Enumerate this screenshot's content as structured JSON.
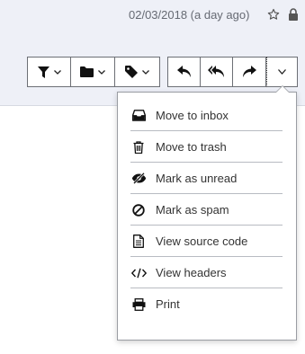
{
  "header": {
    "date": "02/03/2018 (a day ago)",
    "icons": [
      "star-icon",
      "lock-icon"
    ]
  },
  "toolbar": {
    "groups": [
      [
        "filter-icon",
        "folder-icon",
        "tag-icon"
      ],
      [
        "reply-icon",
        "reply-all-icon",
        "forward-icon"
      ],
      [
        "chevron-down-icon"
      ]
    ]
  },
  "menu": {
    "items": [
      {
        "label": "Move to inbox",
        "icon": "inbox-icon"
      },
      {
        "label": "Move to trash",
        "icon": "trash-icon"
      },
      {
        "label": "Mark as unread",
        "icon": "eye-slash-icon"
      },
      {
        "label": "Mark as spam",
        "icon": "ban-icon"
      },
      {
        "label": "View source code",
        "icon": "file-text-icon"
      },
      {
        "label": "View headers",
        "icon": "code-icon"
      },
      {
        "label": "Print",
        "icon": "printer-icon"
      }
    ]
  },
  "colors": {
    "header_background": "#eef0f7",
    "border": "#6c6f75",
    "text": "#333333",
    "muted_text": "#666a73"
  }
}
